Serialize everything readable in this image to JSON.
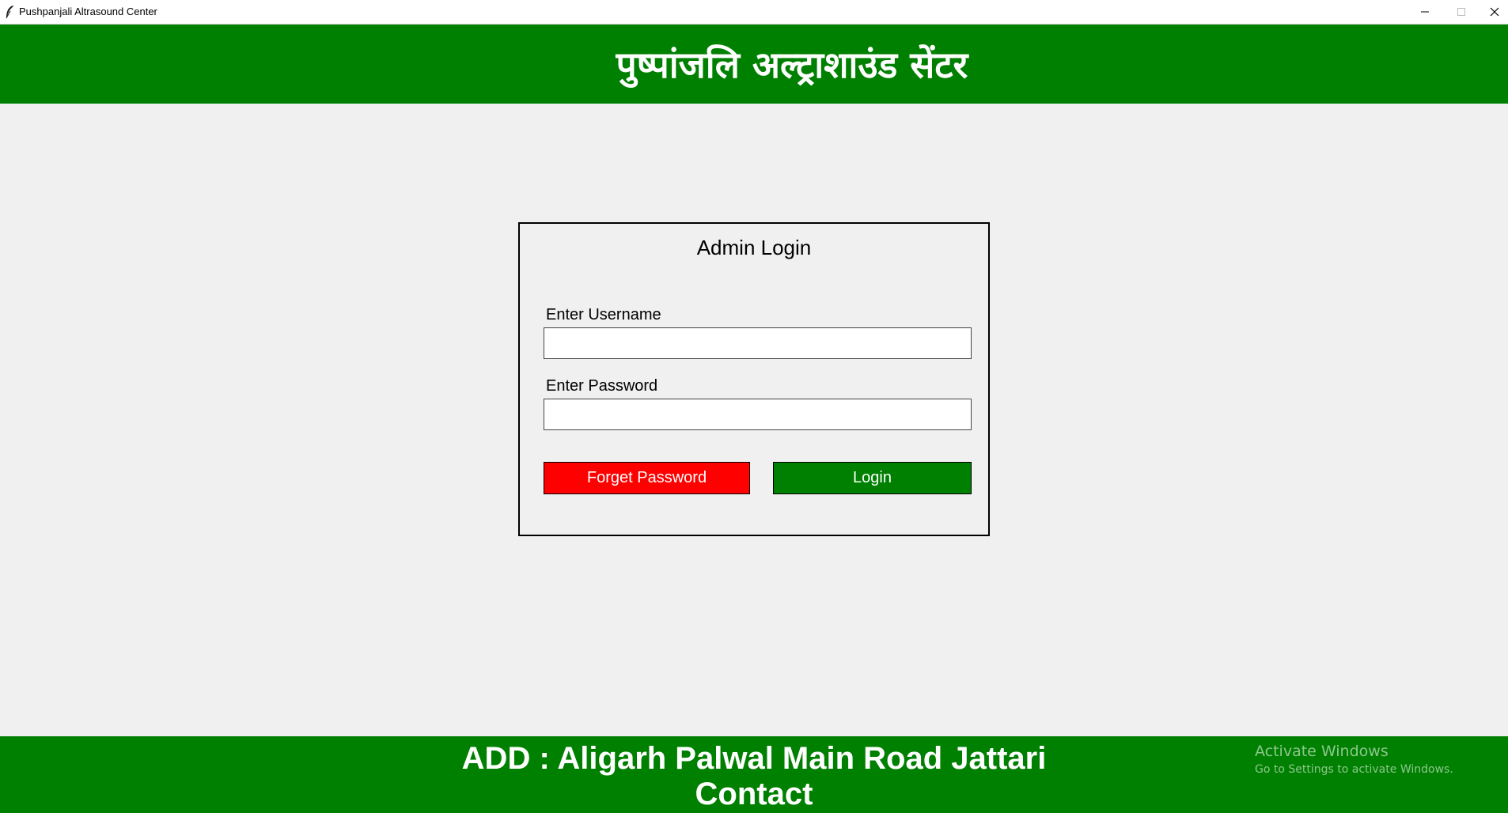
{
  "window": {
    "title": "Pushpanjali Altrasound Center",
    "icon": "feather-icon"
  },
  "header": {
    "title": "पुष्पांजलि अल्ट्राशाउंड सेंटर",
    "background_color": "#008000"
  },
  "login": {
    "heading": "Admin Login",
    "username_label": "Enter Username",
    "username_value": "",
    "password_label": "Enter Password",
    "password_value": "",
    "forget_button": "Forget Password",
    "login_button": "Login",
    "forget_color": "#ff0000",
    "login_color": "#008000"
  },
  "footer": {
    "address": "ADD : Aligarh Palwal Main Road Jattari",
    "contact": "Contact"
  },
  "watermark": {
    "line1": "Activate Windows",
    "line2": "Go to Settings to activate Windows."
  }
}
